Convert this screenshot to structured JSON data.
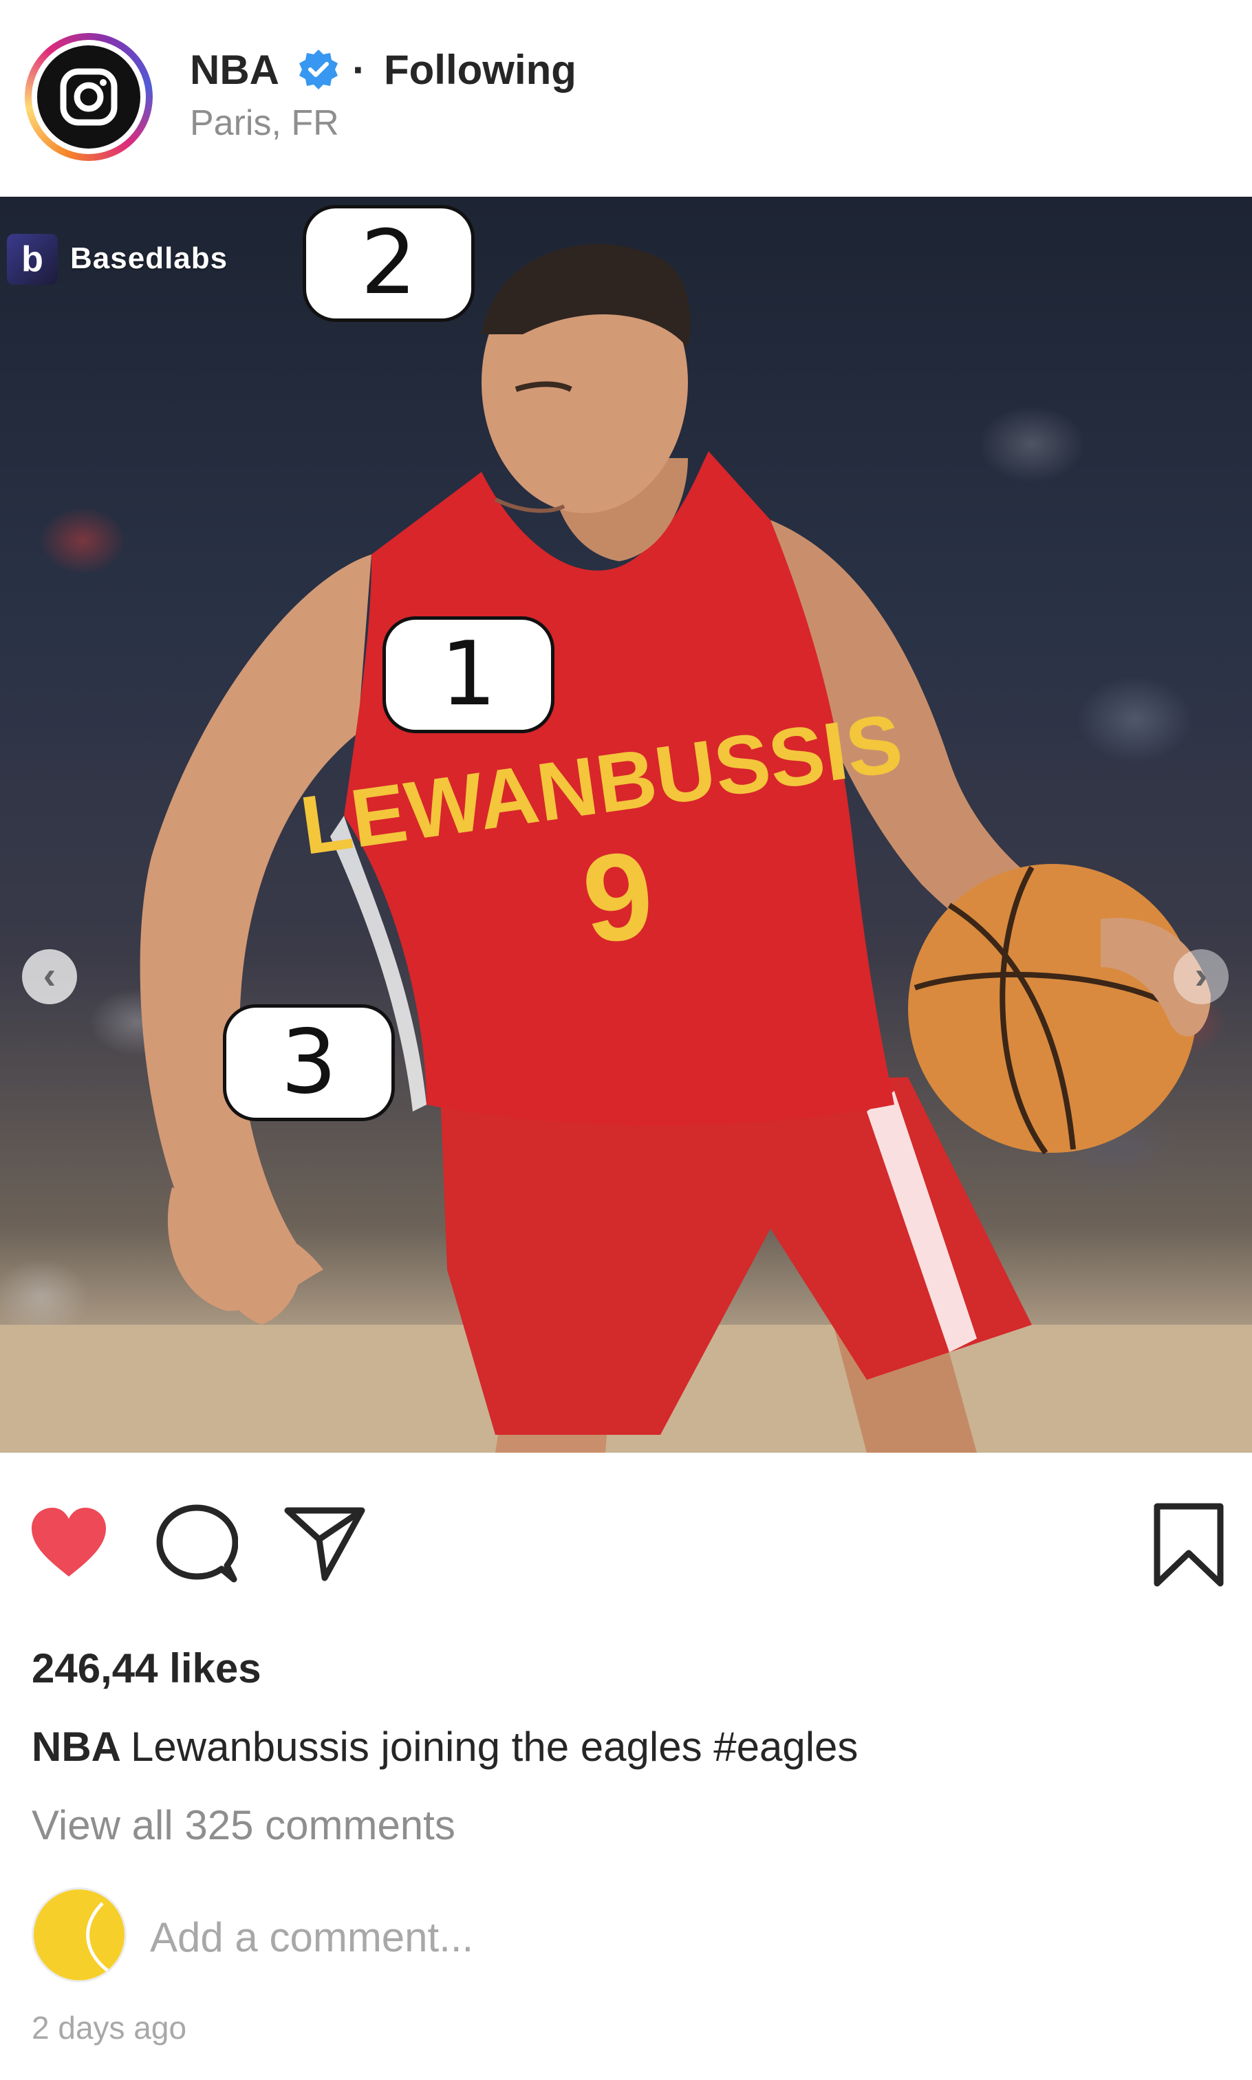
{
  "header": {
    "username": "NBA",
    "separator": "·",
    "follow_status": "Following",
    "location": "Paris, FR",
    "avatar_icon": "instagram-icon",
    "verified_icon": "verified-badge-icon"
  },
  "photo": {
    "watermark": "Basedlabs",
    "watermark_logo": "b",
    "jersey_name": "LEWANBUSSIS",
    "jersey_number": "9",
    "bubbles": [
      "1",
      "2",
      "3"
    ],
    "nav_prev_icon": "chevron-left-icon",
    "nav_next_icon": "chevron-right-icon"
  },
  "actions": {
    "like_icon": "heart-icon",
    "comment_icon": "comment-icon",
    "share_icon": "paper-plane-icon",
    "save_icon": "bookmark-icon",
    "like_color": "#ed4956"
  },
  "post": {
    "likes": "246,44 likes",
    "caption_user": "NBA",
    "caption_text": "Lewanbussis joining the eagles #eagles",
    "view_comments": "View all 325 comments",
    "comment_placeholder": "Add a comment...",
    "timestamp": "2 days ago"
  },
  "colors": {
    "accent_blue": "#3897f0",
    "jersey_red": "#d8262b",
    "jersey_text": "#f3c63c",
    "muted_text": "#8e8e8e"
  }
}
